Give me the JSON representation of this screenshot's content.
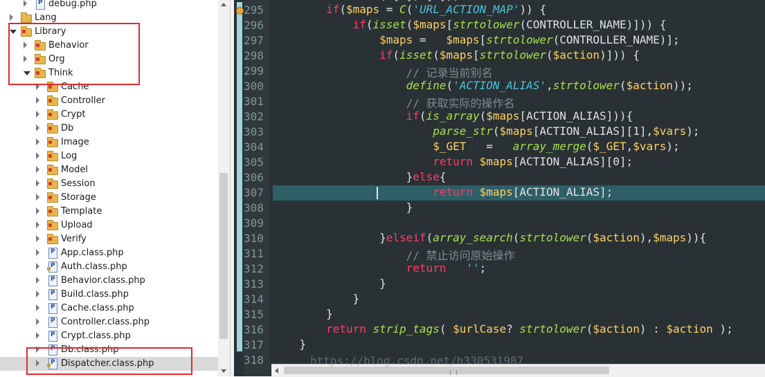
{
  "tree": {
    "items": [
      {
        "label": "debug.php",
        "indent": 1,
        "kind": "php",
        "expander": "closed"
      },
      {
        "label": "Lang",
        "indent": 0,
        "kind": "folder",
        "expander": "closed"
      },
      {
        "label": "Library",
        "indent": 0,
        "kind": "package",
        "expander": "open"
      },
      {
        "label": "Behavior",
        "indent": 1,
        "kind": "package",
        "expander": "closed"
      },
      {
        "label": "Org",
        "indent": 1,
        "kind": "package",
        "expander": "closed"
      },
      {
        "label": "Think",
        "indent": 1,
        "kind": "package",
        "expander": "open"
      },
      {
        "label": "Cache",
        "indent": 2,
        "kind": "package",
        "expander": "closed"
      },
      {
        "label": "Controller",
        "indent": 2,
        "kind": "package",
        "expander": "closed"
      },
      {
        "label": "Crypt",
        "indent": 2,
        "kind": "package",
        "expander": "closed"
      },
      {
        "label": "Db",
        "indent": 2,
        "kind": "package",
        "expander": "closed"
      },
      {
        "label": "Image",
        "indent": 2,
        "kind": "package",
        "expander": "closed"
      },
      {
        "label": "Log",
        "indent": 2,
        "kind": "package",
        "expander": "closed"
      },
      {
        "label": "Model",
        "indent": 2,
        "kind": "package",
        "expander": "closed"
      },
      {
        "label": "Session",
        "indent": 2,
        "kind": "package",
        "expander": "closed"
      },
      {
        "label": "Storage",
        "indent": 2,
        "kind": "package",
        "expander": "closed"
      },
      {
        "label": "Template",
        "indent": 2,
        "kind": "package",
        "expander": "closed"
      },
      {
        "label": "Upload",
        "indent": 2,
        "kind": "package",
        "expander": "closed"
      },
      {
        "label": "Verify",
        "indent": 2,
        "kind": "package",
        "expander": "closed"
      },
      {
        "label": "App.class.php",
        "indent": 2,
        "kind": "php",
        "expander": "closed"
      },
      {
        "label": "Auth.class.php",
        "indent": 2,
        "kind": "php-mod",
        "expander": "closed"
      },
      {
        "label": "Behavior.class.php",
        "indent": 2,
        "kind": "php",
        "expander": "closed"
      },
      {
        "label": "Build.class.php",
        "indent": 2,
        "kind": "php",
        "expander": "closed"
      },
      {
        "label": "Cache.class.php",
        "indent": 2,
        "kind": "php",
        "expander": "closed"
      },
      {
        "label": "Controller.class.php",
        "indent": 2,
        "kind": "php",
        "expander": "closed"
      },
      {
        "label": "Crypt.class.php",
        "indent": 2,
        "kind": "php",
        "expander": "closed"
      },
      {
        "label": "Db.class.php",
        "indent": 2,
        "kind": "php",
        "expander": "closed"
      },
      {
        "label": "Dispatcher.class.php",
        "indent": 2,
        "kind": "php-mod",
        "expander": "closed",
        "selected": true
      }
    ]
  },
  "editor": {
    "lines": [
      {
        "num": "295",
        "tokens": [
          [
            "pl",
            "        "
          ],
          [
            "kw",
            "if"
          ],
          [
            "pl",
            "("
          ],
          [
            "var",
            "$maps"
          ],
          [
            "pl",
            " = "
          ],
          [
            "fn",
            "C"
          ],
          [
            "pl",
            "("
          ],
          [
            "str",
            "'URL_ACTION_MAP'"
          ],
          [
            "pl",
            ")) {"
          ]
        ]
      },
      {
        "num": "296",
        "tokens": [
          [
            "pl",
            "            "
          ],
          [
            "kw",
            "if"
          ],
          [
            "pl",
            "("
          ],
          [
            "fn",
            "isset"
          ],
          [
            "pl",
            "("
          ],
          [
            "var",
            "$maps"
          ],
          [
            "pl",
            "["
          ],
          [
            "fn",
            "strtolower"
          ],
          [
            "pl",
            "(CONTROLLER_NAME)])) {"
          ]
        ]
      },
      {
        "num": "297",
        "tokens": [
          [
            "pl",
            "                "
          ],
          [
            "var",
            "$maps"
          ],
          [
            "pl",
            " =   "
          ],
          [
            "var",
            "$maps"
          ],
          [
            "pl",
            "["
          ],
          [
            "fn",
            "strtolower"
          ],
          [
            "pl",
            "(CONTROLLER_NAME)];"
          ]
        ]
      },
      {
        "num": "298",
        "tokens": [
          [
            "pl",
            "                "
          ],
          [
            "kw",
            "if"
          ],
          [
            "pl",
            "("
          ],
          [
            "fn",
            "isset"
          ],
          [
            "pl",
            "("
          ],
          [
            "var",
            "$maps"
          ],
          [
            "pl",
            "["
          ],
          [
            "fn",
            "strtolower"
          ],
          [
            "pl",
            "("
          ],
          [
            "var",
            "$action"
          ],
          [
            "pl",
            ")])) {"
          ]
        ]
      },
      {
        "num": "299",
        "tokens": [
          [
            "pl",
            "                    "
          ],
          [
            "cm",
            "// 记录当前别名"
          ]
        ]
      },
      {
        "num": "300",
        "tokens": [
          [
            "pl",
            "                    "
          ],
          [
            "fn",
            "define"
          ],
          [
            "pl",
            "("
          ],
          [
            "str",
            "'ACTION_ALIAS'"
          ],
          [
            "pl",
            ","
          ],
          [
            "fn",
            "strtolower"
          ],
          [
            "pl",
            "("
          ],
          [
            "var",
            "$action"
          ],
          [
            "pl",
            "));"
          ]
        ]
      },
      {
        "num": "301",
        "tokens": [
          [
            "pl",
            "                    "
          ],
          [
            "cm",
            "// 获取实际的操作名"
          ]
        ]
      },
      {
        "num": "302",
        "tokens": [
          [
            "pl",
            "                    "
          ],
          [
            "kw",
            "if"
          ],
          [
            "pl",
            "("
          ],
          [
            "fn",
            "is_array"
          ],
          [
            "pl",
            "("
          ],
          [
            "var",
            "$maps"
          ],
          [
            "pl",
            "[ACTION_ALIAS])){"
          ]
        ]
      },
      {
        "num": "303",
        "tokens": [
          [
            "pl",
            "                        "
          ],
          [
            "fn",
            "parse_str"
          ],
          [
            "pl",
            "("
          ],
          [
            "var",
            "$maps"
          ],
          [
            "pl",
            "[ACTION_ALIAS][1],"
          ],
          [
            "var",
            "$vars"
          ],
          [
            "pl",
            ");"
          ]
        ]
      },
      {
        "num": "304",
        "tokens": [
          [
            "pl",
            "                        "
          ],
          [
            "var",
            "$_GET"
          ],
          [
            "pl",
            "   =   "
          ],
          [
            "fn",
            "array_merge"
          ],
          [
            "pl",
            "("
          ],
          [
            "var",
            "$_GET"
          ],
          [
            "pl",
            ","
          ],
          [
            "var",
            "$vars"
          ],
          [
            "pl",
            ");"
          ]
        ]
      },
      {
        "num": "305",
        "tokens": [
          [
            "pl",
            "                        "
          ],
          [
            "kw",
            "return"
          ],
          [
            "pl",
            " "
          ],
          [
            "var",
            "$maps"
          ],
          [
            "pl",
            "[ACTION_ALIAS][0];"
          ]
        ]
      },
      {
        "num": "306",
        "tokens": [
          [
            "pl",
            "                    }"
          ],
          [
            "kw",
            "else"
          ],
          [
            "pl",
            "{"
          ]
        ]
      },
      {
        "num": "307",
        "tokens": [
          [
            "pl",
            "                        "
          ],
          [
            "kw",
            "return"
          ],
          [
            "pl",
            " "
          ],
          [
            "var",
            "$maps"
          ],
          [
            "pl",
            "[ACTION_ALIAS];"
          ]
        ],
        "current": true
      },
      {
        "num": "308",
        "tokens": [
          [
            "pl",
            "                    }"
          ]
        ]
      },
      {
        "num": "309",
        "tokens": [
          [
            "pl",
            ""
          ]
        ]
      },
      {
        "num": "310",
        "tokens": [
          [
            "pl",
            "                }"
          ],
          [
            "kw",
            "elseif"
          ],
          [
            "pl",
            "("
          ],
          [
            "fn",
            "array_search"
          ],
          [
            "pl",
            "("
          ],
          [
            "fn",
            "strtolower"
          ],
          [
            "pl",
            "("
          ],
          [
            "var",
            "$action"
          ],
          [
            "pl",
            "),"
          ],
          [
            "var",
            "$maps"
          ],
          [
            "pl",
            ")){"
          ]
        ]
      },
      {
        "num": "311",
        "tokens": [
          [
            "pl",
            "                    "
          ],
          [
            "cm",
            "// 禁止访问原始操作"
          ]
        ]
      },
      {
        "num": "312",
        "tokens": [
          [
            "pl",
            "                    "
          ],
          [
            "kw",
            "return"
          ],
          [
            "pl",
            "   "
          ],
          [
            "str",
            "''"
          ],
          [
            "pl",
            ";"
          ]
        ]
      },
      {
        "num": "313",
        "tokens": [
          [
            "pl",
            "                }"
          ]
        ]
      },
      {
        "num": "314",
        "tokens": [
          [
            "pl",
            "            }"
          ]
        ]
      },
      {
        "num": "315",
        "tokens": [
          [
            "pl",
            "        }"
          ]
        ]
      },
      {
        "num": "316",
        "tokens": [
          [
            "pl",
            "        "
          ],
          [
            "kw",
            "return"
          ],
          [
            "pl",
            " "
          ],
          [
            "fn",
            "strip_tags"
          ],
          [
            "pl",
            "( "
          ],
          [
            "var",
            "$urlCase"
          ],
          [
            "pl",
            "? "
          ],
          [
            "fn",
            "strtolower"
          ],
          [
            "pl",
            "("
          ],
          [
            "var",
            "$action"
          ],
          [
            "pl",
            ") : "
          ],
          [
            "var",
            "$action"
          ],
          [
            "pl",
            " );"
          ]
        ]
      },
      {
        "num": "317",
        "tokens": [
          [
            "pl",
            "    }"
          ]
        ]
      },
      {
        "num": "318",
        "tokens": [
          [
            "pl",
            ""
          ]
        ]
      }
    ],
    "top_partial": "(…[…],…[…]);",
    "watermark": "https://blog.csdn.net/h330531987"
  },
  "colors": {
    "editor_bg": "#293134",
    "keyword": "#ff3c6a",
    "variable": "#ffd166",
    "function": "#a8e04a",
    "string": "#4fc1d9",
    "comment": "#7d8c93",
    "highlight_box": "#e0292d"
  }
}
